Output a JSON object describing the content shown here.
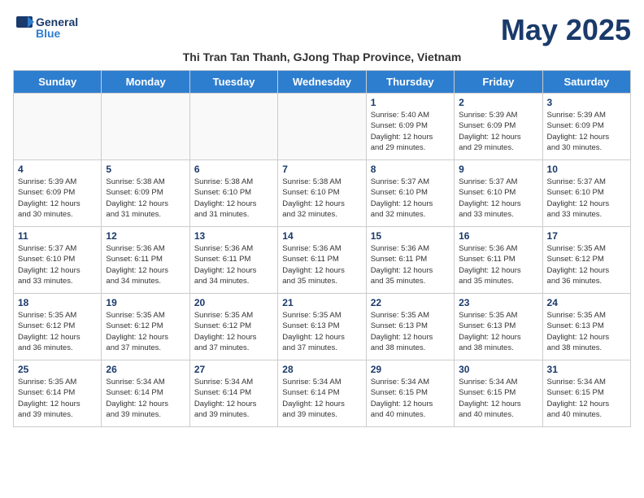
{
  "header": {
    "logo_line1": "General",
    "logo_line2": "Blue",
    "month_title": "May 2025",
    "subtitle": "Thi Tran Tan Thanh, GJong Thap Province, Vietnam"
  },
  "days_of_week": [
    "Sunday",
    "Monday",
    "Tuesday",
    "Wednesday",
    "Thursday",
    "Friday",
    "Saturday"
  ],
  "weeks": [
    [
      {
        "day": "",
        "info": ""
      },
      {
        "day": "",
        "info": ""
      },
      {
        "day": "",
        "info": ""
      },
      {
        "day": "",
        "info": ""
      },
      {
        "day": "1",
        "info": "Sunrise: 5:40 AM\nSunset: 6:09 PM\nDaylight: 12 hours\nand 29 minutes."
      },
      {
        "day": "2",
        "info": "Sunrise: 5:39 AM\nSunset: 6:09 PM\nDaylight: 12 hours\nand 29 minutes."
      },
      {
        "day": "3",
        "info": "Sunrise: 5:39 AM\nSunset: 6:09 PM\nDaylight: 12 hours\nand 30 minutes."
      }
    ],
    [
      {
        "day": "4",
        "info": "Sunrise: 5:39 AM\nSunset: 6:09 PM\nDaylight: 12 hours\nand 30 minutes."
      },
      {
        "day": "5",
        "info": "Sunrise: 5:38 AM\nSunset: 6:09 PM\nDaylight: 12 hours\nand 31 minutes."
      },
      {
        "day": "6",
        "info": "Sunrise: 5:38 AM\nSunset: 6:10 PM\nDaylight: 12 hours\nand 31 minutes."
      },
      {
        "day": "7",
        "info": "Sunrise: 5:38 AM\nSunset: 6:10 PM\nDaylight: 12 hours\nand 32 minutes."
      },
      {
        "day": "8",
        "info": "Sunrise: 5:37 AM\nSunset: 6:10 PM\nDaylight: 12 hours\nand 32 minutes."
      },
      {
        "day": "9",
        "info": "Sunrise: 5:37 AM\nSunset: 6:10 PM\nDaylight: 12 hours\nand 33 minutes."
      },
      {
        "day": "10",
        "info": "Sunrise: 5:37 AM\nSunset: 6:10 PM\nDaylight: 12 hours\nand 33 minutes."
      }
    ],
    [
      {
        "day": "11",
        "info": "Sunrise: 5:37 AM\nSunset: 6:10 PM\nDaylight: 12 hours\nand 33 minutes."
      },
      {
        "day": "12",
        "info": "Sunrise: 5:36 AM\nSunset: 6:11 PM\nDaylight: 12 hours\nand 34 minutes."
      },
      {
        "day": "13",
        "info": "Sunrise: 5:36 AM\nSunset: 6:11 PM\nDaylight: 12 hours\nand 34 minutes."
      },
      {
        "day": "14",
        "info": "Sunrise: 5:36 AM\nSunset: 6:11 PM\nDaylight: 12 hours\nand 35 minutes."
      },
      {
        "day": "15",
        "info": "Sunrise: 5:36 AM\nSunset: 6:11 PM\nDaylight: 12 hours\nand 35 minutes."
      },
      {
        "day": "16",
        "info": "Sunrise: 5:36 AM\nSunset: 6:11 PM\nDaylight: 12 hours\nand 35 minutes."
      },
      {
        "day": "17",
        "info": "Sunrise: 5:35 AM\nSunset: 6:12 PM\nDaylight: 12 hours\nand 36 minutes."
      }
    ],
    [
      {
        "day": "18",
        "info": "Sunrise: 5:35 AM\nSunset: 6:12 PM\nDaylight: 12 hours\nand 36 minutes."
      },
      {
        "day": "19",
        "info": "Sunrise: 5:35 AM\nSunset: 6:12 PM\nDaylight: 12 hours\nand 37 minutes."
      },
      {
        "day": "20",
        "info": "Sunrise: 5:35 AM\nSunset: 6:12 PM\nDaylight: 12 hours\nand 37 minutes."
      },
      {
        "day": "21",
        "info": "Sunrise: 5:35 AM\nSunset: 6:13 PM\nDaylight: 12 hours\nand 37 minutes."
      },
      {
        "day": "22",
        "info": "Sunrise: 5:35 AM\nSunset: 6:13 PM\nDaylight: 12 hours\nand 38 minutes."
      },
      {
        "day": "23",
        "info": "Sunrise: 5:35 AM\nSunset: 6:13 PM\nDaylight: 12 hours\nand 38 minutes."
      },
      {
        "day": "24",
        "info": "Sunrise: 5:35 AM\nSunset: 6:13 PM\nDaylight: 12 hours\nand 38 minutes."
      }
    ],
    [
      {
        "day": "25",
        "info": "Sunrise: 5:35 AM\nSunset: 6:14 PM\nDaylight: 12 hours\nand 39 minutes."
      },
      {
        "day": "26",
        "info": "Sunrise: 5:34 AM\nSunset: 6:14 PM\nDaylight: 12 hours\nand 39 minutes."
      },
      {
        "day": "27",
        "info": "Sunrise: 5:34 AM\nSunset: 6:14 PM\nDaylight: 12 hours\nand 39 minutes."
      },
      {
        "day": "28",
        "info": "Sunrise: 5:34 AM\nSunset: 6:14 PM\nDaylight: 12 hours\nand 39 minutes."
      },
      {
        "day": "29",
        "info": "Sunrise: 5:34 AM\nSunset: 6:15 PM\nDaylight: 12 hours\nand 40 minutes."
      },
      {
        "day": "30",
        "info": "Sunrise: 5:34 AM\nSunset: 6:15 PM\nDaylight: 12 hours\nand 40 minutes."
      },
      {
        "day": "31",
        "info": "Sunrise: 5:34 AM\nSunset: 6:15 PM\nDaylight: 12 hours\nand 40 minutes."
      }
    ]
  ]
}
